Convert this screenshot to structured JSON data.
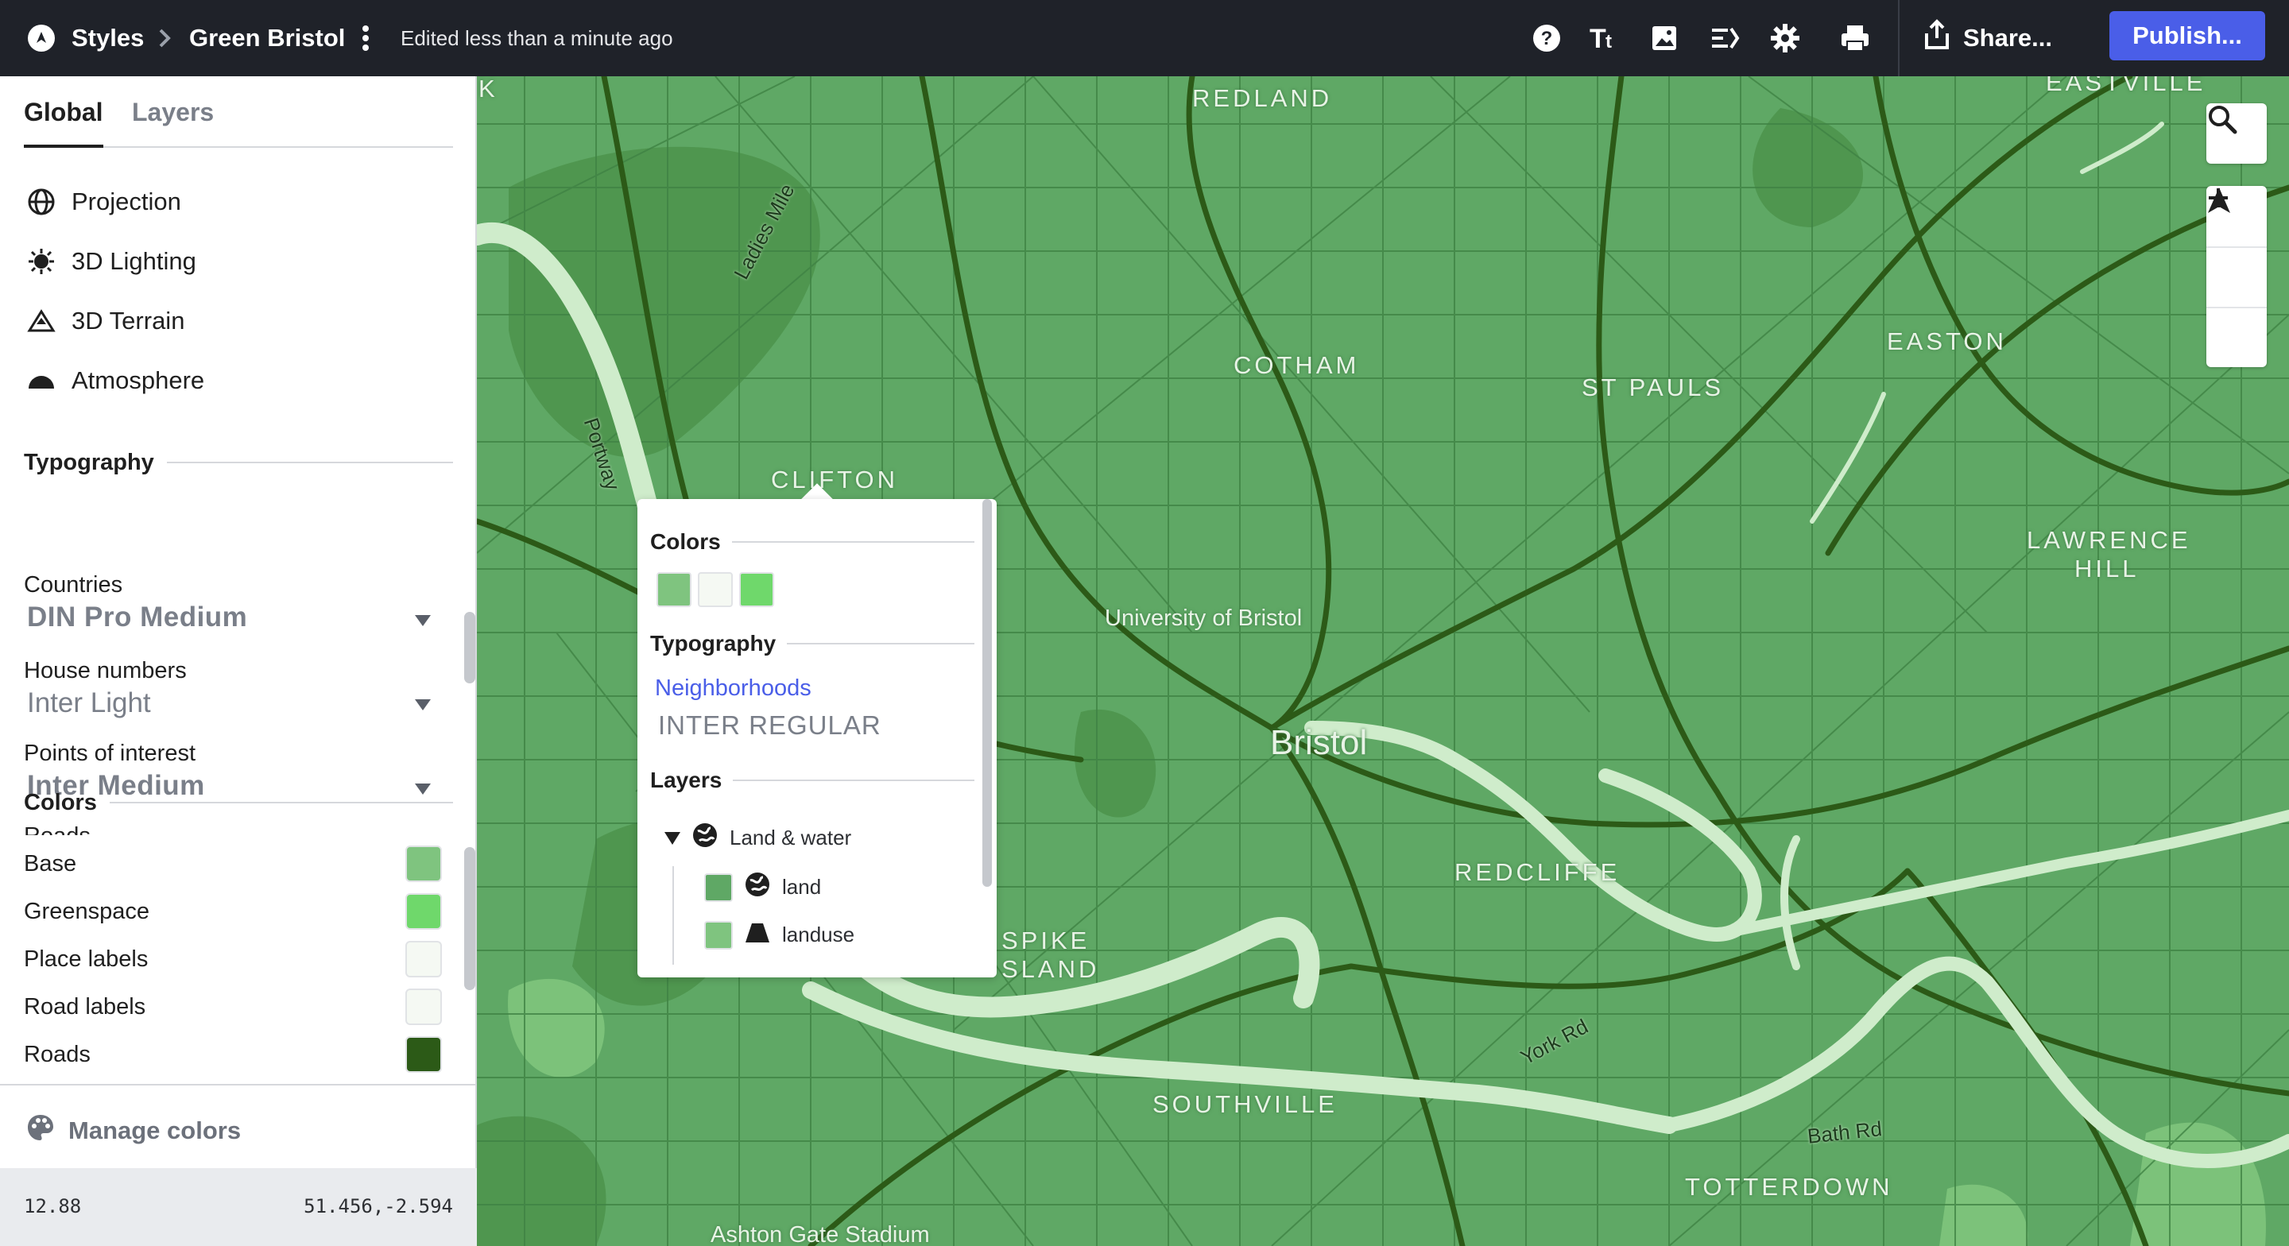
{
  "topbar": {
    "crumb_styles": "Styles",
    "style_name": "Green Bristol",
    "edited": "Edited less than a minute ago",
    "share_label": "Share...",
    "publish_label": "Publish..."
  },
  "panel": {
    "tabs": {
      "global": "Global",
      "layers": "Layers"
    },
    "nav": {
      "projection": "Projection",
      "lighting": "3D Lighting",
      "terrain": "3D Terrain",
      "atmosphere": "Atmosphere"
    },
    "typography": {
      "heading": "Typography",
      "items": [
        {
          "label": "Countries",
          "font": "DIN Pro Medium"
        },
        {
          "label": "House numbers",
          "font": "Inter Light"
        },
        {
          "label": "Points of interest",
          "font": "Inter Medium"
        },
        {
          "label": "Roads",
          "font": ""
        }
      ]
    },
    "colors": {
      "heading": "Colors",
      "items": [
        {
          "label": "Base",
          "color": "#7fc47f"
        },
        {
          "label": "Greenspace",
          "color": "#6fd86b"
        },
        {
          "label": "Place labels",
          "color": "#f5f9f3"
        },
        {
          "label": "Road labels",
          "color": "#f5f9f3"
        },
        {
          "label": "Roads",
          "color": "#2c5a17"
        }
      ]
    },
    "manage_colors": "Manage colors",
    "status": {
      "zoom": "12.88",
      "coords": "51.456,-2.594"
    }
  },
  "map": {
    "labels": {
      "redland": "REDLAND",
      "eastville": "EASTVILLE",
      "cotham": "COTHAM",
      "st_pauls": "ST PAULS",
      "easton": "EASTON",
      "clifton": "CLIFTON",
      "lawrence_hill_1": "LAWRENCE",
      "lawrence_hill_2": "HILL",
      "university": "University of Bristol",
      "bristol": "Bristol",
      "redcliffe": "REDCLIFFE",
      "spike_1": "SPIKE",
      "spike_2": "SLAND",
      "southville": "SOUTHVILLE",
      "totterdown": "TOTTERDOWN",
      "ashton": "Ashton Gate Stadium",
      "k": "K"
    },
    "roads": {
      "ladies_mile": "Ladies Mile",
      "portway": "Portway",
      "york_rd": "York Rd",
      "bath_rd": "Bath Rd"
    }
  },
  "popup": {
    "colors_heading": "Colors",
    "swatches": [
      "#7fc47f",
      "#f5f9f3",
      "#6fd86b"
    ],
    "typography_heading": "Typography",
    "typography_label": "Neighborhoods",
    "typography_font": "INTER REGULAR",
    "layers_heading": "Layers",
    "group": "Land & water",
    "layers": [
      {
        "name": "land",
        "color": "#5fa865"
      },
      {
        "name": "landuse",
        "color": "#7fc47f"
      }
    ]
  }
}
